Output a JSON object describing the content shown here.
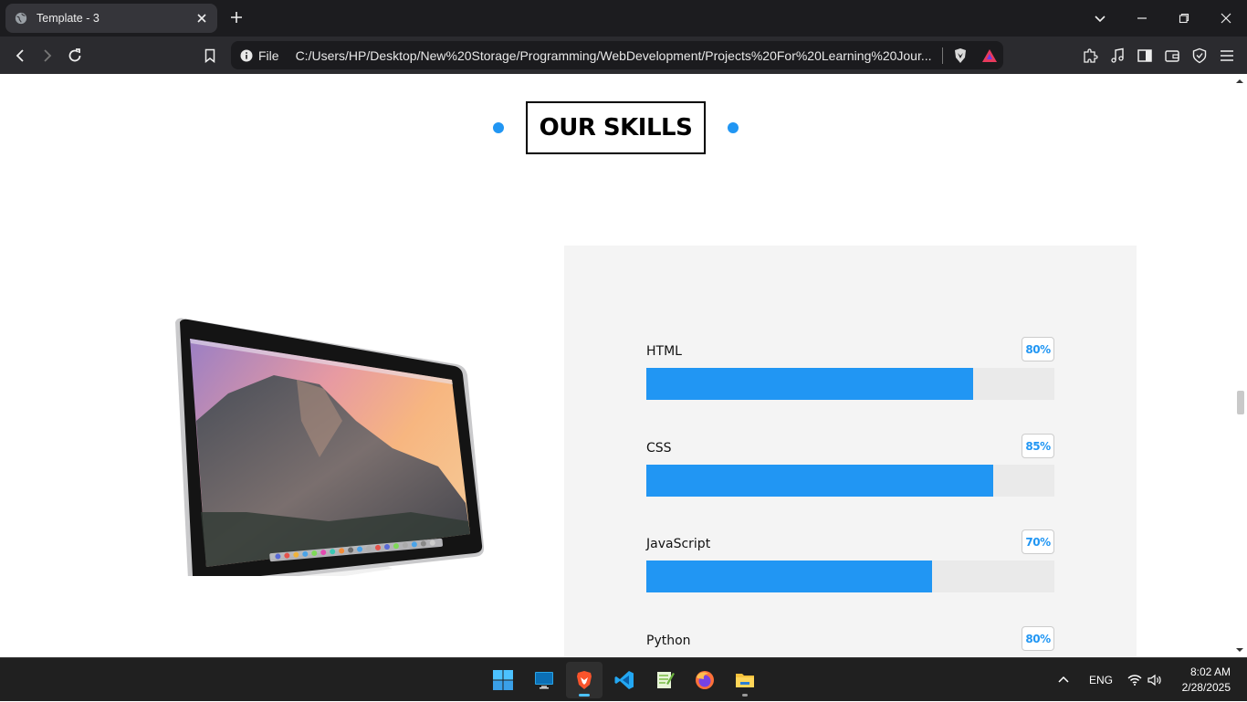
{
  "browser": {
    "tab_title": "Template - 3",
    "file_label": "File",
    "url": "C:/Users/HP/Desktop/New%20Storage/Programming/WebDevelopment/Projects%20For%20Learning%20Jour..."
  },
  "page": {
    "section_title": "OUR SKILLS",
    "accent_color": "#2196f3",
    "skills": [
      {
        "name": "HTML",
        "percent_label": "80%",
        "percent": 80
      },
      {
        "name": "CSS",
        "percent_label": "85%",
        "percent": 85
      },
      {
        "name": "JavaScript",
        "percent_label": "70%",
        "percent": 70
      },
      {
        "name": "Python",
        "percent_label": "80%",
        "percent": 80
      }
    ]
  },
  "taskbar": {
    "apps": [
      "windows-start",
      "desktop",
      "brave-browser",
      "vs-code",
      "notepad-plus-plus",
      "firefox",
      "file-explorer"
    ],
    "language": "ENG",
    "time": "8:02 AM",
    "date": "2/28/2025"
  }
}
